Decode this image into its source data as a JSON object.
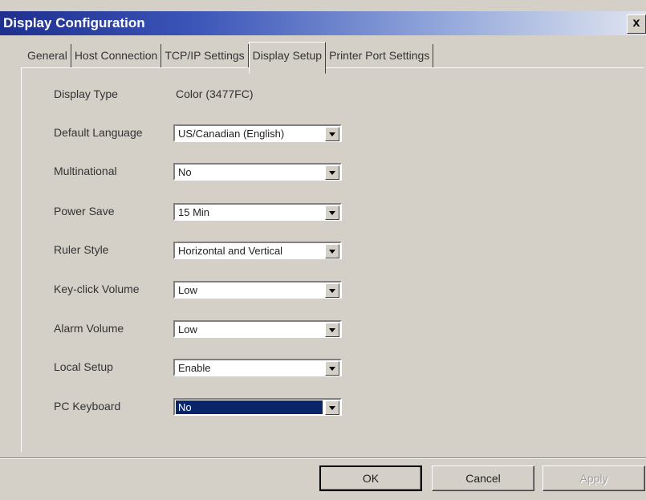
{
  "window": {
    "title": "Display Configuration",
    "close_label": "x"
  },
  "tabs": [
    {
      "label": "General"
    },
    {
      "label": "Host Connection"
    },
    {
      "label": "TCP/IP Settings"
    },
    {
      "label": "Display Setup"
    },
    {
      "label": "Printer Port Settings"
    }
  ],
  "active_tab": "Display Setup",
  "display_type": {
    "label": "Display Type",
    "value": "Color (3477FC)"
  },
  "fields": [
    {
      "label": "Default Language",
      "value": "US/Canadian (English)"
    },
    {
      "label": "Multinational",
      "value": "No"
    },
    {
      "label": "Power Save",
      "value": "15 Min"
    },
    {
      "label": "Ruler Style",
      "value": "Horizontal and Vertical"
    },
    {
      "label": "Key-click Volume",
      "value": "Low"
    },
    {
      "label": "Alarm Volume",
      "value": "Low"
    },
    {
      "label": "Local Setup",
      "value": "Enable"
    },
    {
      "label": "PC Keyboard",
      "value": "No"
    }
  ],
  "buttons": {
    "ok": "OK",
    "cancel": "Cancel",
    "apply": "Apply"
  },
  "colors": {
    "selection": "#0a246a",
    "title_start": "#1e2f8e",
    "face": "#d4d0c8"
  }
}
